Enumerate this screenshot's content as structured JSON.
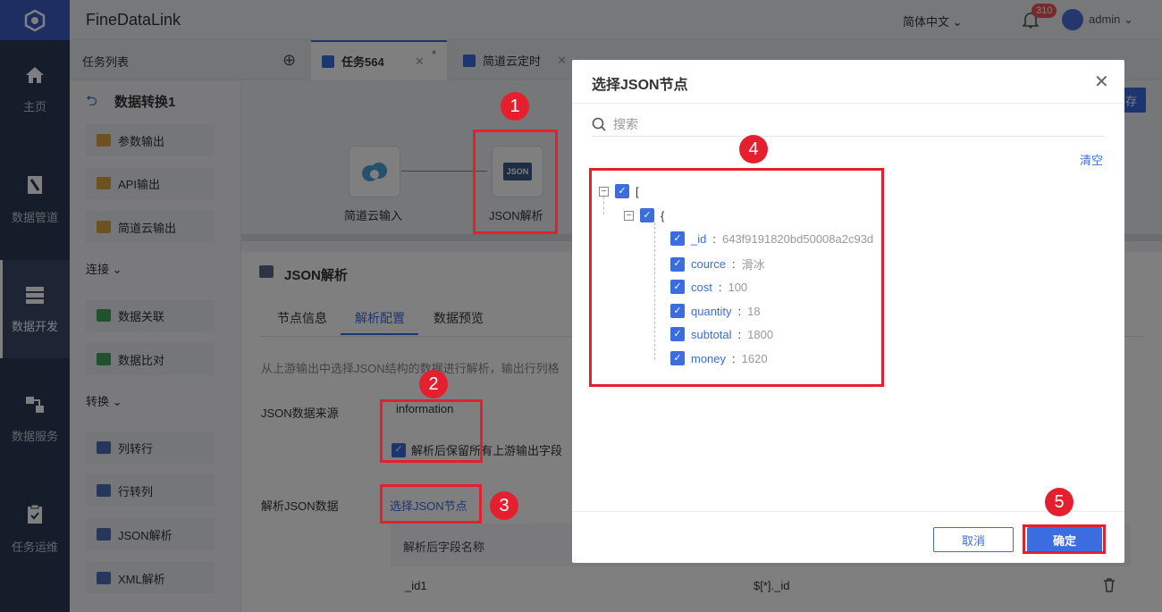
{
  "nav": {
    "items": [
      {
        "label": "主页"
      },
      {
        "label": "数据管道"
      },
      {
        "label": "数据开发"
      },
      {
        "label": "数据服务"
      },
      {
        "label": "任务运维"
      }
    ]
  },
  "header": {
    "app_title": "FineDataLink",
    "language": "简体中文",
    "notifications": "310",
    "user": "admin"
  },
  "tabs": {
    "task_list": "任务列表",
    "items": [
      {
        "label": "任务564",
        "modified": "*"
      },
      {
        "label": "简道云定时"
      }
    ]
  },
  "sidebar": {
    "title": "数据转换1",
    "items_top": [
      "参数输出",
      "API输出",
      "简道云输出"
    ],
    "group1": "连接",
    "items_g1": [
      "数据关联",
      "数据比对"
    ],
    "group2": "转换",
    "items_g2": [
      "列转行",
      "行转列",
      "JSON解析",
      "XML解析"
    ]
  },
  "canvas": {
    "nodes": [
      {
        "label": "简道云输入"
      },
      {
        "label": "JSON解析"
      }
    ],
    "json_tag": "JSON"
  },
  "panel": {
    "title": "JSON解析",
    "tabs": [
      "节点信息",
      "解析配置",
      "数据预览"
    ],
    "desc": "从上游输出中选择JSON结构的数据进行解析，输出行列格",
    "source_label": "JSON数据来源",
    "source_value": "information",
    "keep_label": "解析后保留所有上游输出字段",
    "parse_label": "解析JSON数据",
    "select_link": "选择JSON节点",
    "col_header": "解析后字段名称",
    "row1_name": "_id1",
    "row1_path": "$[*]._id",
    "partial_btn": "存"
  },
  "dialog": {
    "title": "选择JSON节点",
    "search_placeholder": "搜索",
    "clear": "清空",
    "tree": {
      "root": "[",
      "obj": "{",
      "leaves": [
        {
          "key": "_id",
          "value": "643f9191820bd50008a2c93d"
        },
        {
          "key": "cource",
          "value": "滑冰"
        },
        {
          "key": "cost",
          "value": "100"
        },
        {
          "key": "quantity",
          "value": "18"
        },
        {
          "key": "subtotal",
          "value": "1800"
        },
        {
          "key": "money",
          "value": "1620"
        }
      ]
    },
    "cancel": "取消",
    "ok": "确定"
  },
  "markers": [
    "1",
    "2",
    "3",
    "4",
    "5"
  ],
  "colors": {
    "accent": "#3b6de0",
    "annotation": "#e5202e",
    "nav_bg": "#2c3a55"
  }
}
